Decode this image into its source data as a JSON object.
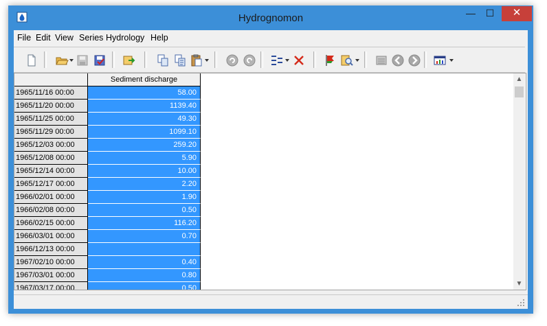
{
  "window": {
    "title": "Hydrognomon",
    "minimize_glyph": "—",
    "maximize_glyph": "☐",
    "close_glyph": "✕",
    "accent_color": "#3c8fd8",
    "close_color": "#c7403a"
  },
  "menu": {
    "items": [
      "File",
      "Edit",
      "View",
      "Series",
      "Hydrology",
      "Help"
    ]
  },
  "toolbar": {
    "icons": [
      "new-document-icon",
      "open-folder-icon",
      "save-icon",
      "save-checked-icon",
      "import-icon",
      "copy-icon",
      "copy-special-icon",
      "paste-icon",
      "undo-icon",
      "redo-icon",
      "insert-row-icon",
      "delete-icon",
      "flag-icon",
      "find-icon",
      "calculator-icon",
      "back-icon",
      "forward-icon",
      "chart-icon"
    ]
  },
  "grid": {
    "selection_color": "#3397ff",
    "column_header": "Sediment discharge",
    "rows": [
      {
        "date": "1965/11/16 00:00",
        "value": "58.00"
      },
      {
        "date": "1965/11/20 00:00",
        "value": "1139.40"
      },
      {
        "date": "1965/11/25 00:00",
        "value": "49.30"
      },
      {
        "date": "1965/11/29 00:00",
        "value": "1099.10"
      },
      {
        "date": "1965/12/03 00:00",
        "value": "259.20"
      },
      {
        "date": "1965/12/08 00:00",
        "value": "5.90"
      },
      {
        "date": "1965/12/14 00:00",
        "value": "10.00"
      },
      {
        "date": "1965/12/17 00:00",
        "value": "2.20"
      },
      {
        "date": "1966/02/01 00:00",
        "value": "1.90"
      },
      {
        "date": "1966/02/08 00:00",
        "value": "0.50"
      },
      {
        "date": "1966/02/15 00:00",
        "value": "116.20"
      },
      {
        "date": "1966/03/01 00:00",
        "value": "0.70"
      },
      {
        "date": "1966/12/13 00:00",
        "value": ""
      },
      {
        "date": "1967/02/10 00:00",
        "value": "0.40"
      },
      {
        "date": "1967/03/01 00:00",
        "value": "0.80"
      },
      {
        "date": "1967/03/17 00:00",
        "value": "0.50"
      }
    ]
  },
  "scrollbar": {
    "up_glyph": "▲",
    "down_glyph": "▼"
  }
}
